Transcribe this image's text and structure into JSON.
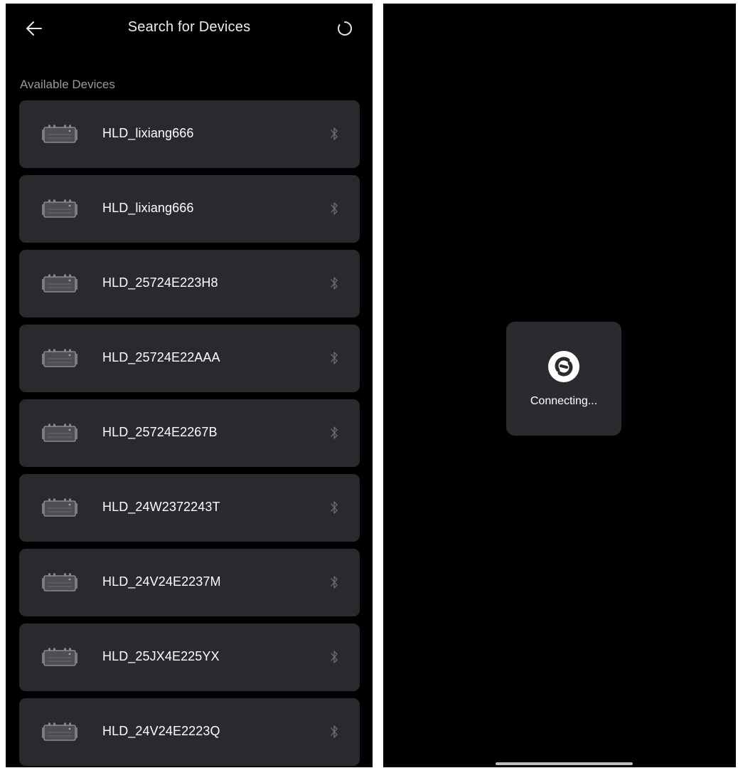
{
  "search_screen": {
    "title": "Search for Devices",
    "back_icon": "arrow-left-icon",
    "refresh_icon": "refresh-circle-icon",
    "section_label": "Available Devices",
    "devices": [
      {
        "name": "HLD_lixiang666",
        "icon": "inverter-device-icon",
        "status_icon": "bluetooth-icon"
      },
      {
        "name": "HLD_lixiang666",
        "icon": "inverter-device-icon",
        "status_icon": "bluetooth-icon"
      },
      {
        "name": "HLD_25724E223H8",
        "icon": "inverter-device-icon",
        "status_icon": "bluetooth-icon"
      },
      {
        "name": "HLD_25724E22AAA",
        "icon": "inverter-device-icon",
        "status_icon": "bluetooth-icon"
      },
      {
        "name": "HLD_25724E2267B",
        "icon": "inverter-device-icon",
        "status_icon": "bluetooth-icon"
      },
      {
        "name": "HLD_24W2372243T",
        "icon": "inverter-device-icon",
        "status_icon": "bluetooth-icon"
      },
      {
        "name": "HLD_24V24E2237M",
        "icon": "inverter-device-icon",
        "status_icon": "bluetooth-icon"
      },
      {
        "name": "HLD_25JX4E225YX",
        "icon": "inverter-device-icon",
        "status_icon": "bluetooth-icon"
      },
      {
        "name": "HLD_24V24E2223Q",
        "icon": "inverter-device-icon",
        "status_icon": "bluetooth-icon"
      }
    ]
  },
  "connecting_screen": {
    "status_text": "Connecting...",
    "icon": "connecting-sync-icon"
  },
  "colors": {
    "screen_background": "#000000",
    "card_background": "#2a292e",
    "primary_text": "#ffffff",
    "secondary_text": "#9a9a9a",
    "icon_muted": "#6f6f6f"
  }
}
